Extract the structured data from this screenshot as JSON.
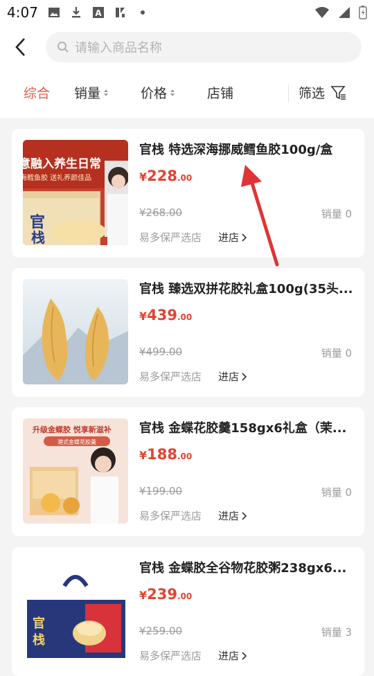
{
  "status": {
    "time": "4:07"
  },
  "search": {
    "placeholder": "请输入商品名称"
  },
  "filters": {
    "comprehensive": "综合",
    "sales": "销量",
    "price": "价格",
    "store": "店铺",
    "filter": "筛选"
  },
  "products": [
    {
      "title": "官栈 特选深海挪威鳕鱼胶100g/盒",
      "currency": "¥",
      "price_int": "228",
      "price_dec": ".00",
      "original": "¥268.00",
      "sales": "销量 0",
      "store": "易多保严选店",
      "enter": "进店",
      "image_text": [
        "意融入养生日常",
        "海鳕鱼胶 送礼养颜佳品",
        "官",
        "栈"
      ]
    },
    {
      "title": "官栈 臻选双拼花胶礼盒100g(35头...",
      "currency": "¥",
      "price_int": "439",
      "price_dec": ".00",
      "original": "¥499.00",
      "sales": "销量 0",
      "store": "易多保严选店",
      "enter": "进店",
      "image_text": []
    },
    {
      "title": "官栈 金蝶花胶羹158gx6礼盒（茉...",
      "currency": "¥",
      "price_int": "188",
      "price_dec": ".00",
      "original": "¥199.00",
      "sales": "销量 0",
      "store": "易多保严选店",
      "enter": "进店",
      "image_text": [
        "升级金蝶胶 悦享新滋补",
        "港式金蝶花胶羹"
      ]
    },
    {
      "title": "官栈 金蝶胶全谷物花胶粥238gx6...",
      "currency": "¥",
      "price_int": "239",
      "price_dec": ".00",
      "original": "¥259.00",
      "sales": "销量 3",
      "store": "易多保严选店",
      "enter": "进店",
      "image_text": [
        "官",
        "栈"
      ]
    }
  ],
  "colors": {
    "accent": "#e35b48",
    "price": "#e3432f",
    "arrow": "#e03434"
  }
}
